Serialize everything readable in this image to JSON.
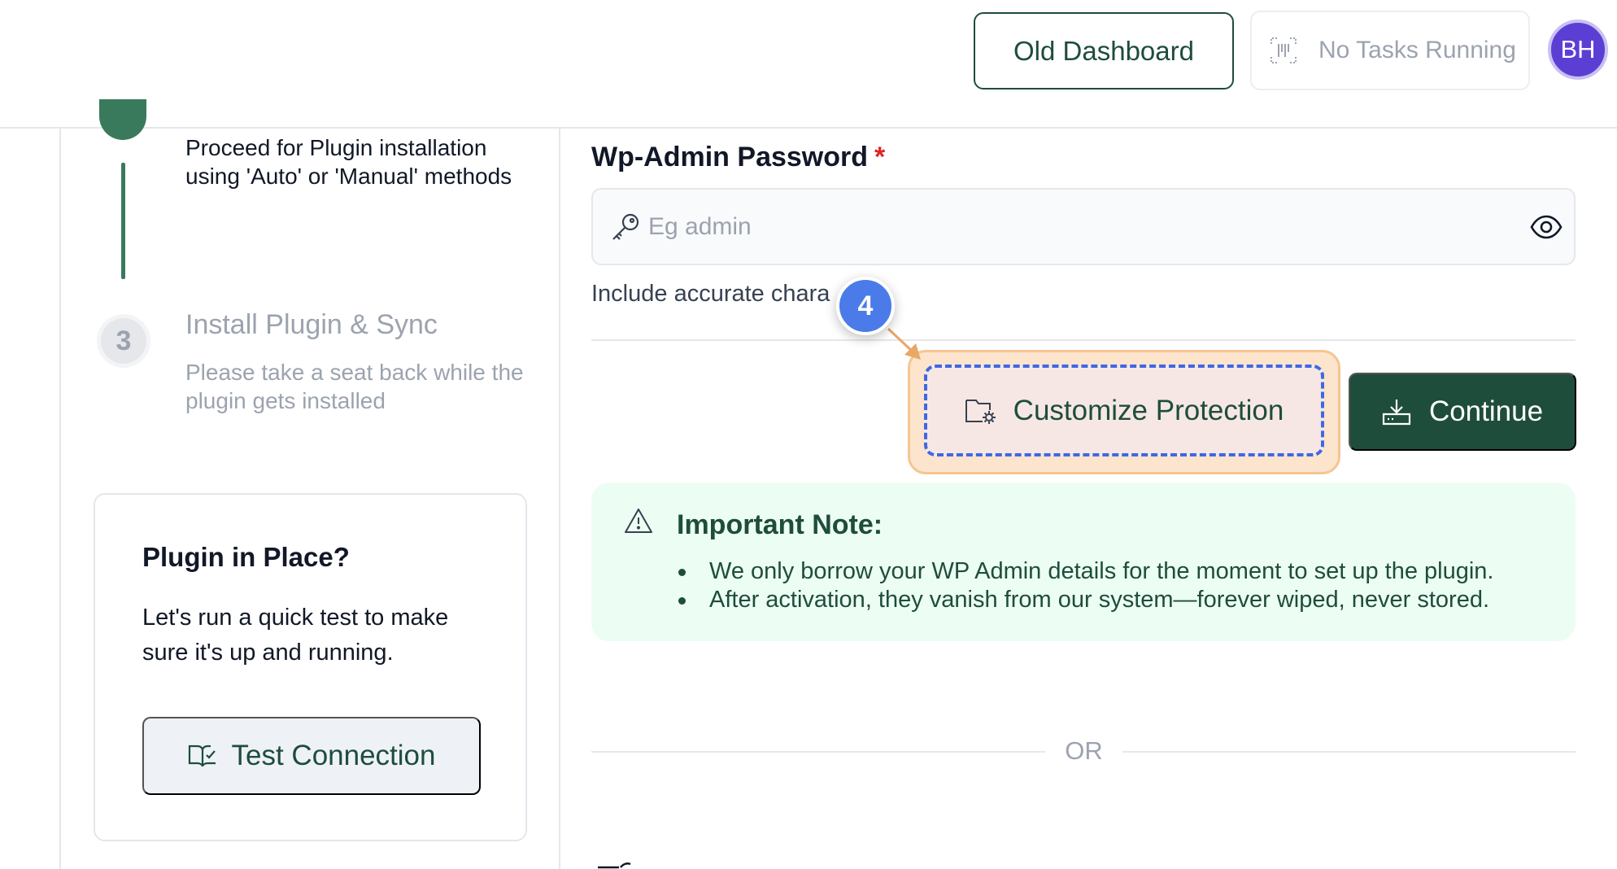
{
  "header": {
    "old_dashboard_label": "Old Dashboard",
    "tasks_label": "No Tasks Running",
    "avatar_initials": "BH"
  },
  "steps": {
    "step2_description": "Proceed for Plugin installation using 'Auto' or 'Manual' methods",
    "step3_number": "3",
    "step3_title": "Install Plugin & Sync",
    "step3_description": "Please take a seat back while the plugin gets installed"
  },
  "plugin_card": {
    "title": "Plugin in Place?",
    "description": "Let's run a quick test to make sure it's up and running.",
    "test_button_label": "Test Connection"
  },
  "form": {
    "password_label": "Wp-Admin Password",
    "required_marker": "*",
    "password_placeholder": "Eg admin",
    "hint_text": "Include accurate chara"
  },
  "tutorial": {
    "step_badge": "4"
  },
  "actions": {
    "customize_label": "Customize Protection",
    "continue_label": "Continue"
  },
  "note": {
    "title": "Important Note:",
    "items": [
      "We only borrow your WP Admin details for the moment to set up the plugin.",
      "After activation, they vanish from our system—forever wiped, never stored."
    ]
  },
  "divider": {
    "or_label": "OR"
  },
  "colors": {
    "brand_green": "#1e4d3b",
    "step_green": "#3a7a5c",
    "highlight_blue": "#3f68e2",
    "badge_blue": "#4a7be9",
    "highlight_orange": "#f6c592",
    "note_bg": "#ecfdf3",
    "avatar_purple": "#5b3fd4"
  },
  "icons": [
    "scan-icon",
    "key-icon",
    "eye-icon",
    "folder-settings-icon",
    "download-tray-icon",
    "warning-icon",
    "book-check-icon"
  ]
}
